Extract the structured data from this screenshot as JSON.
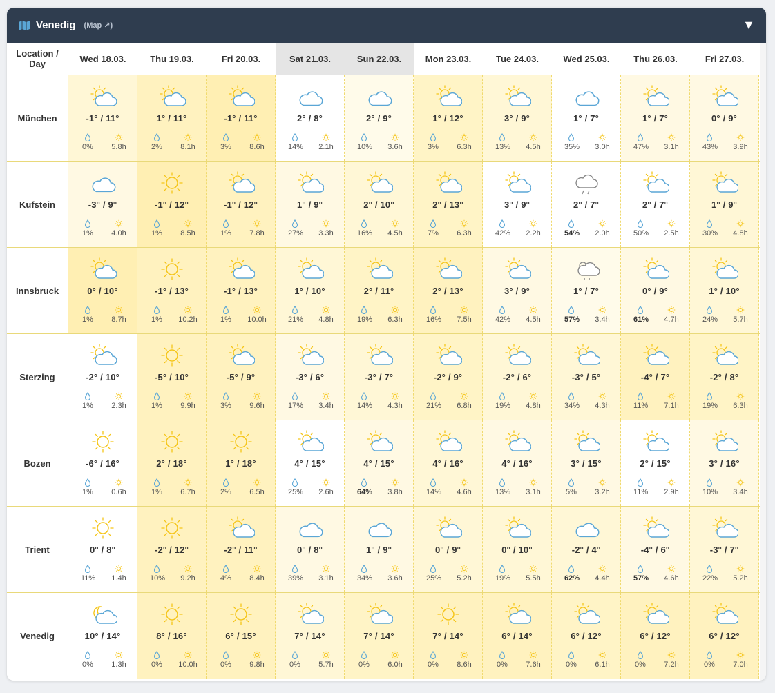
{
  "header": {
    "title": "Venedig",
    "map_link": "(Map ↗)"
  },
  "table": {
    "corner_label_line1": "Location /",
    "corner_label_line2": "Day",
    "days": [
      {
        "label": "Wed 18.03.",
        "weekend": false
      },
      {
        "label": "Thu 19.03.",
        "weekend": false
      },
      {
        "label": "Fri 20.03.",
        "weekend": false
      },
      {
        "label": "Sat 21.03.",
        "weekend": true
      },
      {
        "label": "Sun 22.03.",
        "weekend": true
      },
      {
        "label": "Mon 23.03.",
        "weekend": false
      },
      {
        "label": "Tue 24.03.",
        "weekend": false
      },
      {
        "label": "Wed 25.03.",
        "weekend": false
      },
      {
        "label": "Thu 26.03.",
        "weekend": false
      },
      {
        "label": "Fri 27.03.",
        "weekend": false
      }
    ],
    "rows": [
      {
        "location": "München",
        "cells": [
          {
            "icon": "partly",
            "temp": "-1° / 11°",
            "rain": "0%",
            "sun": "5.8h",
            "bg": "#fff7d6",
            "hl": false
          },
          {
            "icon": "partly",
            "temp": "1° / 11°",
            "rain": "2%",
            "sun": "8.1h",
            "bg": "#fff2bf",
            "hl": false
          },
          {
            "icon": "partly",
            "temp": "-1° / 11°",
            "rain": "3%",
            "sun": "8.6h",
            "bg": "#ffefb3",
            "hl": false
          },
          {
            "icon": "cloudy",
            "temp": "2° / 8°",
            "rain": "14%",
            "sun": "2.1h",
            "bg": "#ffffff",
            "hl": false
          },
          {
            "icon": "cloudy",
            "temp": "2° / 9°",
            "rain": "10%",
            "sun": "3.6h",
            "bg": "#fffbea",
            "hl": false
          },
          {
            "icon": "partly",
            "temp": "1° / 12°",
            "rain": "3%",
            "sun": "6.3h",
            "bg": "#fff4c6",
            "hl": false
          },
          {
            "icon": "partly",
            "temp": "3° / 9°",
            "rain": "13%",
            "sun": "4.5h",
            "bg": "#fff7d6",
            "hl": false
          },
          {
            "icon": "cloudy",
            "temp": "1° / 7°",
            "rain": "35%",
            "sun": "3.0h",
            "bg": "#ffffff",
            "hl": false
          },
          {
            "icon": "partly",
            "temp": "1° / 7°",
            "rain": "47%",
            "sun": "3.1h",
            "bg": "#fff9e3",
            "hl": false
          },
          {
            "icon": "partly",
            "temp": "0° / 9°",
            "rain": "43%",
            "sun": "3.9h",
            "bg": "#fff9e3",
            "hl": false
          }
        ]
      },
      {
        "location": "Kufstein",
        "cells": [
          {
            "icon": "cloudy",
            "temp": "-3° / 9°",
            "rain": "1%",
            "sun": "4.0h",
            "bg": "#fff9e3",
            "hl": false
          },
          {
            "icon": "sunny",
            "temp": "-1° / 12°",
            "rain": "1%",
            "sun": "8.5h",
            "bg": "#ffefb3",
            "hl": false
          },
          {
            "icon": "partly",
            "temp": "-1° / 12°",
            "rain": "1%",
            "sun": "7.8h",
            "bg": "#fff2bf",
            "hl": false
          },
          {
            "icon": "partly",
            "temp": "1° / 9°",
            "rain": "27%",
            "sun": "3.3h",
            "bg": "#fff9e3",
            "hl": false
          },
          {
            "icon": "partly",
            "temp": "2° / 10°",
            "rain": "16%",
            "sun": "4.5h",
            "bg": "#fff7d6",
            "hl": false
          },
          {
            "icon": "partly",
            "temp": "2° / 13°",
            "rain": "7%",
            "sun": "6.3h",
            "bg": "#fff4c6",
            "hl": false
          },
          {
            "icon": "partly",
            "temp": "3° / 9°",
            "rain": "42%",
            "sun": "2.2h",
            "bg": "#ffffff",
            "hl": false
          },
          {
            "icon": "rain",
            "temp": "2° / 7°",
            "rain": "54%",
            "sun": "2.0h",
            "bg": "#ffffff",
            "hl": true
          },
          {
            "icon": "partly",
            "temp": "2° / 7°",
            "rain": "50%",
            "sun": "2.5h",
            "bg": "#ffffff",
            "hl": false
          },
          {
            "icon": "partly",
            "temp": "1° / 9°",
            "rain": "30%",
            "sun": "4.8h",
            "bg": "#fff7d6",
            "hl": false
          }
        ]
      },
      {
        "location": "Innsbruck",
        "cells": [
          {
            "icon": "partly",
            "temp": "0° / 10°",
            "rain": "1%",
            "sun": "8.7h",
            "bg": "#ffefb3",
            "hl": false
          },
          {
            "icon": "sunny",
            "temp": "-1° / 13°",
            "rain": "1%",
            "sun": "10.2h",
            "bg": "#fff2bf",
            "hl": false
          },
          {
            "icon": "partly",
            "temp": "-1° / 13°",
            "rain": "1%",
            "sun": "10.0h",
            "bg": "#fff2bf",
            "hl": false
          },
          {
            "icon": "partly",
            "temp": "1° / 10°",
            "rain": "21%",
            "sun": "4.8h",
            "bg": "#fff7d6",
            "hl": false
          },
          {
            "icon": "partly",
            "temp": "2° / 11°",
            "rain": "19%",
            "sun": "6.3h",
            "bg": "#fff4c6",
            "hl": false
          },
          {
            "icon": "partly",
            "temp": "2° / 13°",
            "rain": "16%",
            "sun": "7.5h",
            "bg": "#fff2bf",
            "hl": false
          },
          {
            "icon": "partly",
            "temp": "3° / 9°",
            "rain": "42%",
            "sun": "4.5h",
            "bg": "#fff9e3",
            "hl": false
          },
          {
            "icon": "snow",
            "temp": "1° / 7°",
            "rain": "57%",
            "sun": "3.4h",
            "bg": "#fffbea",
            "hl": true
          },
          {
            "icon": "partly",
            "temp": "0° / 9°",
            "rain": "61%",
            "sun": "4.7h",
            "bg": "#fff9e3",
            "hl": true
          },
          {
            "icon": "partly",
            "temp": "1° / 10°",
            "rain": "24%",
            "sun": "5.7h",
            "bg": "#fff7d6",
            "hl": false
          }
        ]
      },
      {
        "location": "Sterzing",
        "cells": [
          {
            "icon": "partly",
            "temp": "-2° / 10°",
            "rain": "1%",
            "sun": "2.3h",
            "bg": "#ffffff",
            "hl": false
          },
          {
            "icon": "sunny",
            "temp": "-5° / 10°",
            "rain": "1%",
            "sun": "9.9h",
            "bg": "#fff2bf",
            "hl": false
          },
          {
            "icon": "partly",
            "temp": "-5° / 9°",
            "rain": "3%",
            "sun": "9.6h",
            "bg": "#fff2bf",
            "hl": false
          },
          {
            "icon": "partly",
            "temp": "-3° / 6°",
            "rain": "17%",
            "sun": "3.4h",
            "bg": "#fff9e3",
            "hl": false
          },
          {
            "icon": "partly",
            "temp": "-3° / 7°",
            "rain": "14%",
            "sun": "4.3h",
            "bg": "#fff7d6",
            "hl": false
          },
          {
            "icon": "partly",
            "temp": "-2° / 9°",
            "rain": "21%",
            "sun": "6.8h",
            "bg": "#fff4c6",
            "hl": false
          },
          {
            "icon": "partly",
            "temp": "-2° / 6°",
            "rain": "19%",
            "sun": "4.8h",
            "bg": "#fff7d6",
            "hl": false
          },
          {
            "icon": "partly",
            "temp": "-3° / 5°",
            "rain": "34%",
            "sun": "4.3h",
            "bg": "#fff7d6",
            "hl": false
          },
          {
            "icon": "partly",
            "temp": "-4° / 7°",
            "rain": "11%",
            "sun": "7.1h",
            "bg": "#fff2bf",
            "hl": false
          },
          {
            "icon": "partly",
            "temp": "-2° / 8°",
            "rain": "19%",
            "sun": "6.3h",
            "bg": "#fff4c6",
            "hl": false
          }
        ]
      },
      {
        "location": "Bozen",
        "cells": [
          {
            "icon": "sunny",
            "temp": "-6° / 16°",
            "rain": "1%",
            "sun": "0.6h",
            "bg": "#ffffff",
            "hl": false
          },
          {
            "icon": "sunny",
            "temp": "2° / 18°",
            "rain": "1%",
            "sun": "6.7h",
            "bg": "#fff2bf",
            "hl": false
          },
          {
            "icon": "sunny",
            "temp": "1° / 18°",
            "rain": "2%",
            "sun": "6.5h",
            "bg": "#fff2bf",
            "hl": false
          },
          {
            "icon": "partly",
            "temp": "4° / 15°",
            "rain": "25%",
            "sun": "2.6h",
            "bg": "#ffffff",
            "hl": false
          },
          {
            "icon": "partly",
            "temp": "4° / 15°",
            "rain": "64%",
            "sun": "3.8h",
            "bg": "#fff9e3",
            "hl": true
          },
          {
            "icon": "partly",
            "temp": "4° / 16°",
            "rain": "14%",
            "sun": "4.6h",
            "bg": "#fff7d6",
            "hl": false
          },
          {
            "icon": "partly",
            "temp": "4° / 16°",
            "rain": "13%",
            "sun": "3.1h",
            "bg": "#fff9e3",
            "hl": false
          },
          {
            "icon": "partly",
            "temp": "3° / 15°",
            "rain": "5%",
            "sun": "3.2h",
            "bg": "#fff9e3",
            "hl": false
          },
          {
            "icon": "partly",
            "temp": "2° / 15°",
            "rain": "11%",
            "sun": "2.9h",
            "bg": "#ffffff",
            "hl": false
          },
          {
            "icon": "partly",
            "temp": "3° / 16°",
            "rain": "10%",
            "sun": "3.4h",
            "bg": "#fff9e3",
            "hl": false
          }
        ]
      },
      {
        "location": "Trient",
        "cells": [
          {
            "icon": "sunny",
            "temp": "0° / 8°",
            "rain": "11%",
            "sun": "1.4h",
            "bg": "#ffffff",
            "hl": false
          },
          {
            "icon": "sunny",
            "temp": "-2° / 12°",
            "rain": "10%",
            "sun": "9.2h",
            "bg": "#fff2bf",
            "hl": false
          },
          {
            "icon": "partly",
            "temp": "-2° / 11°",
            "rain": "4%",
            "sun": "8.4h",
            "bg": "#fff2bf",
            "hl": false
          },
          {
            "icon": "cloudy",
            "temp": "0° / 8°",
            "rain": "39%",
            "sun": "3.1h",
            "bg": "#fff9e3",
            "hl": false
          },
          {
            "icon": "cloudy",
            "temp": "1° / 9°",
            "rain": "34%",
            "sun": "3.6h",
            "bg": "#fff9e3",
            "hl": false
          },
          {
            "icon": "partly",
            "temp": "0° / 9°",
            "rain": "25%",
            "sun": "5.2h",
            "bg": "#fff7d6",
            "hl": false
          },
          {
            "icon": "partly",
            "temp": "0° / 10°",
            "rain": "19%",
            "sun": "5.5h",
            "bg": "#fff7d6",
            "hl": false
          },
          {
            "icon": "cloudy",
            "temp": "-2° / 4°",
            "rain": "62%",
            "sun": "4.4h",
            "bg": "#fff7d6",
            "hl": true
          },
          {
            "icon": "partly",
            "temp": "-4° / 6°",
            "rain": "57%",
            "sun": "4.6h",
            "bg": "#fff9e3",
            "hl": true
          },
          {
            "icon": "partly",
            "temp": "-3° / 7°",
            "rain": "22%",
            "sun": "5.2h",
            "bg": "#fff7d6",
            "hl": false
          }
        ]
      },
      {
        "location": "Venedig",
        "cells": [
          {
            "icon": "moon",
            "temp": "10° / 14°",
            "rain": "0%",
            "sun": "1.3h",
            "bg": "#ffffff",
            "hl": false
          },
          {
            "icon": "sunny",
            "temp": "8° / 16°",
            "rain": "0%",
            "sun": "10.0h",
            "bg": "#fff2bf",
            "hl": false
          },
          {
            "icon": "sunny",
            "temp": "6° / 15°",
            "rain": "0%",
            "sun": "9.8h",
            "bg": "#fff2bf",
            "hl": false
          },
          {
            "icon": "partly",
            "temp": "7° / 14°",
            "rain": "0%",
            "sun": "5.7h",
            "bg": "#fff7d6",
            "hl": false
          },
          {
            "icon": "partly",
            "temp": "7° / 14°",
            "rain": "0%",
            "sun": "6.0h",
            "bg": "#fff4c6",
            "hl": false
          },
          {
            "icon": "sunny",
            "temp": "7° / 14°",
            "rain": "0%",
            "sun": "8.6h",
            "bg": "#fff2bf",
            "hl": false
          },
          {
            "icon": "partly",
            "temp": "6° / 14°",
            "rain": "0%",
            "sun": "7.6h",
            "bg": "#fff2bf",
            "hl": false
          },
          {
            "icon": "partly",
            "temp": "6° / 12°",
            "rain": "0%",
            "sun": "6.1h",
            "bg": "#fff4c6",
            "hl": false
          },
          {
            "icon": "partly",
            "temp": "6° / 12°",
            "rain": "0%",
            "sun": "7.2h",
            "bg": "#fff2bf",
            "hl": false
          },
          {
            "icon": "partly",
            "temp": "6° / 12°",
            "rain": "0%",
            "sun": "7.0h",
            "bg": "#fff2bf",
            "hl": false
          }
        ]
      }
    ]
  },
  "colors": {
    "header_bg": "#2f3d4f",
    "sun": "#f5c518",
    "cloud": "#5aa6d6",
    "drop": "#5aa6d6"
  }
}
